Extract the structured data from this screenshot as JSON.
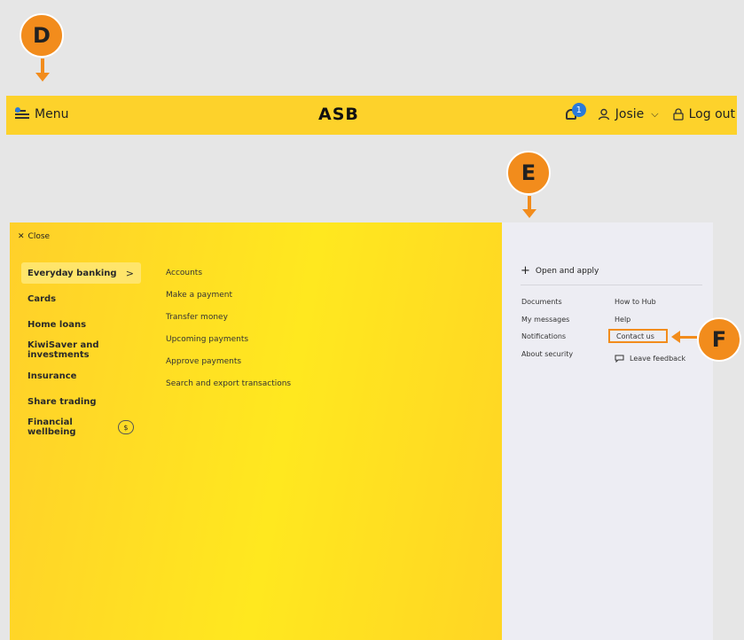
{
  "annotations": {
    "d": "D",
    "e": "E",
    "f": "F"
  },
  "header": {
    "menu_label": "Menu",
    "logo": "ASB",
    "notification_count": "1",
    "user_name": "Josie",
    "logout_label": "Log out"
  },
  "menu": {
    "close_label": "Close",
    "categories": [
      {
        "label": "Everyday banking",
        "active": true
      },
      {
        "label": "Cards"
      },
      {
        "label": "Home loans"
      },
      {
        "label": "KiwiSaver and investments"
      },
      {
        "label": "Insurance"
      },
      {
        "label": "Share trading"
      },
      {
        "label": "Financial wellbeing"
      }
    ],
    "wellbeing_icon_text": "$",
    "subitems": [
      "Accounts",
      "Make a payment",
      "Transfer money",
      "Upcoming payments",
      "Approve payments",
      "Search and export transactions"
    ]
  },
  "side": {
    "open_apply_label": "Open and apply",
    "col_a": [
      "Documents",
      "My messages",
      "Notifications",
      "About security"
    ],
    "col_b": [
      "How to Hub",
      "Help",
      "Contact us",
      "Leave feedback"
    ]
  },
  "colors": {
    "accent_orange": "#f28c1c",
    "brand_yellow": "#fdd22b",
    "badge_blue": "#2a7ad9",
    "side_panel": "#ededf3"
  }
}
